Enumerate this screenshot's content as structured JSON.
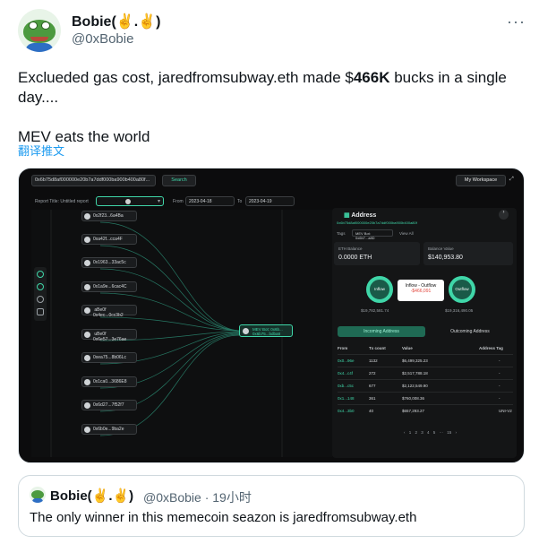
{
  "author": {
    "name": "Bobie(✌️.✌️)",
    "handle": "@0xBobie",
    "more_label": "···"
  },
  "tweet": {
    "text_pre": "Exclueded gas cost, jaredfromsubway.eth made $",
    "text_bold": "466K",
    "text_post": " bucks in a single day....",
    "text_line2": "MEV eats the world",
    "translate_label": "翻译推文"
  },
  "media": {
    "search_value": "0x6b75d8af000000e20b7a7ddf000ba900b400a80f...",
    "search_button": "Search",
    "workspace_button": "My Workspace",
    "expand_icon": "⤢",
    "report_title": "Report Title: Untitled report",
    "from_label": "From",
    "from_date": "2023-04-18",
    "to_label": "To",
    "to_date": "2023-04-19",
    "nodes": [
      "0x2f23...6a4Ba",
      "0xa42f...cca4F",
      "0x1963...33ac5c",
      "0x1a9e...6cac4C",
      " aBe0f\n0x4ec...0cc3b2",
      " uBe0f\n0x6e57...3e76ae",
      "0xea75...8b06Lc",
      "0x1ca0...3686E8",
      "0x6d27...7f52f7",
      "0x6b0e...9ba2e"
    ],
    "mev_label": "MEV Bot: 0x6b...\n0x6b75...bdba8",
    "panel": {
      "title": "Address",
      "address": "0x6b75d8af000000e20b7a7ddf000ba900b400a80f",
      "tags_label": "Tags",
      "tag_value": "MEV Bot: 0x6b7...a8D",
      "view_all": "View All",
      "eth_balance_label": "ETH Balance",
      "eth_balance": "0.0000 ETH",
      "balance_value_label": "Balance Value",
      "balance_value": "$140,953.80",
      "inflow_label": "Inflow",
      "outflow_label": "Outflow",
      "flow_title": "Inflow - Outflow",
      "flow_value": "-$466,091",
      "inflow_value": "$19,782,581.74",
      "outflow_value": "$19,316,490.05",
      "tab_in": "Incoming Address",
      "tab_out": "Outcoming Address",
      "col_from": "From",
      "col_count": "Tx count",
      "col_value": "Value",
      "col_tag": "Address Tag",
      "rows": [
        {
          "from": "0x0...96e",
          "count": "1132",
          "value": "$6,499,325.23",
          "tag": "-"
        },
        {
          "from": "0x4...c4f",
          "count": "272",
          "value": "$2,517,788.18",
          "tag": "-"
        },
        {
          "from": "0xb...c5c",
          "count": "677",
          "value": "$2,122,549.90",
          "tag": "-"
        },
        {
          "from": "0x1...148",
          "count": "361",
          "value": "$760,008.36",
          "tag": "-"
        },
        {
          "from": "0x4...3b0",
          "count": "40",
          "value": "$657,293.27",
          "tag": "UNI-V2"
        }
      ],
      "pages": "‹ 1 2 3 4 5 ··· 15 ›"
    }
  },
  "quote": {
    "name": "Bobie(✌️.✌️)",
    "meta": "@0xBobie · 19小时",
    "text": "The only winner in this memecoin seazon is jaredfromsubway.eth"
  }
}
